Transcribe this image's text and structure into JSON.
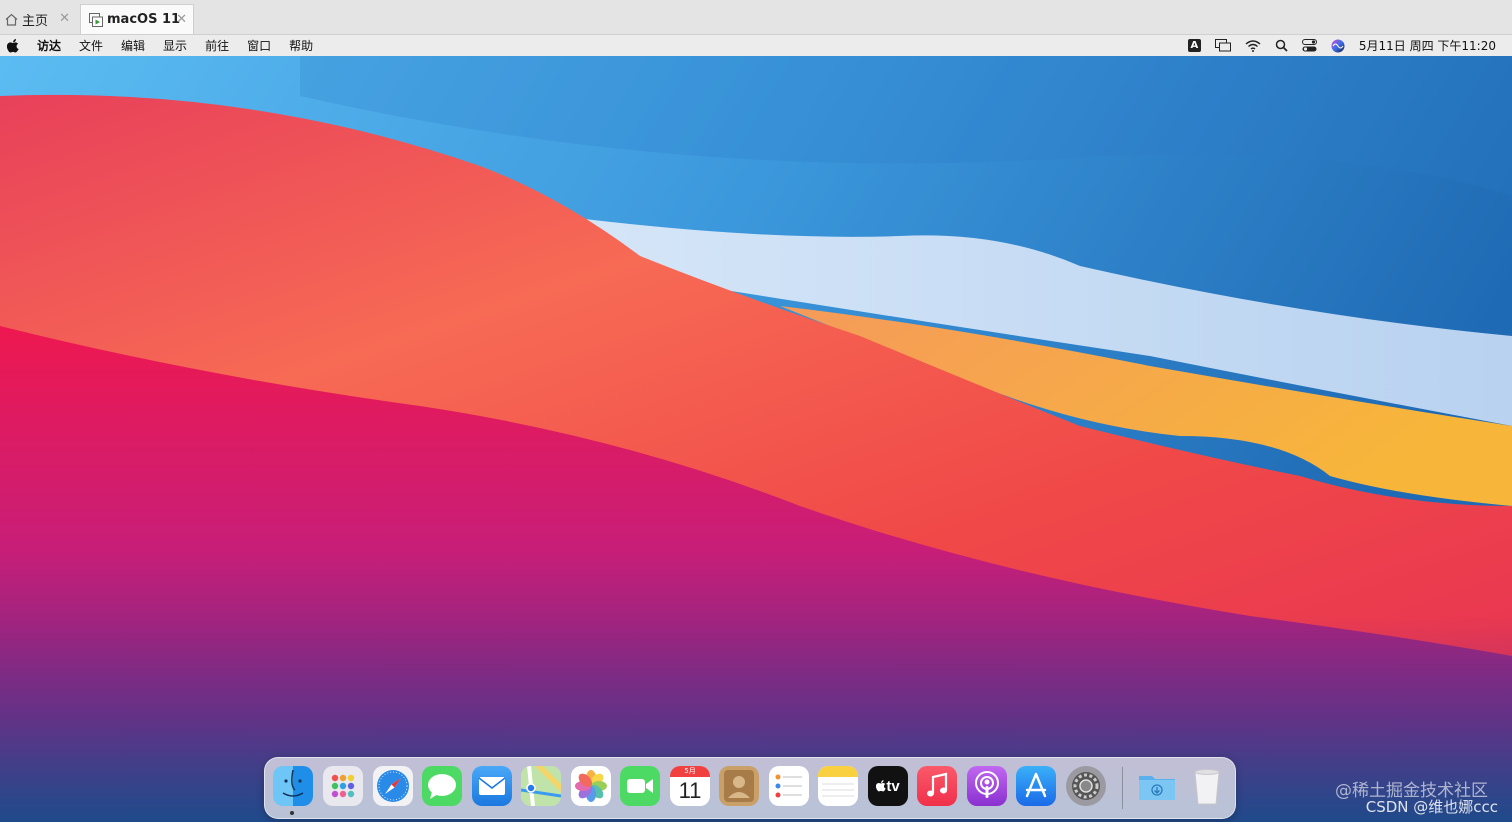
{
  "vmware_tabs": [
    {
      "label": "主页"
    },
    {
      "label": "macOS 11"
    }
  ],
  "menubar": {
    "items": [
      "访达",
      "文件",
      "编辑",
      "显示",
      "前往",
      "窗口",
      "帮助"
    ],
    "status_icons": [
      "input-source-icon",
      "screen-mirroring-icon",
      "wifi-icon",
      "spotlight-icon",
      "control-center-icon",
      "siri-icon"
    ],
    "input_source_label": "A",
    "clock": "5月11日 周四 下午11:20"
  },
  "dock": {
    "apps": [
      "Finder",
      "Launchpad",
      "Safari",
      "Messages",
      "Mail",
      "Maps",
      "Photos",
      "FaceTime",
      "Calendar",
      "Contacts",
      "Reminders",
      "Notes",
      "TV",
      "Music",
      "Podcasts",
      "App Store",
      "System Preferences"
    ],
    "calendar_month": "5月",
    "calendar_day": "11",
    "tv_label": "tv",
    "right": [
      "Downloads",
      "Trash"
    ]
  },
  "watermark": {
    "line1": "@稀土掘金技术社区",
    "line2": "CSDN @维也娜ccc"
  }
}
